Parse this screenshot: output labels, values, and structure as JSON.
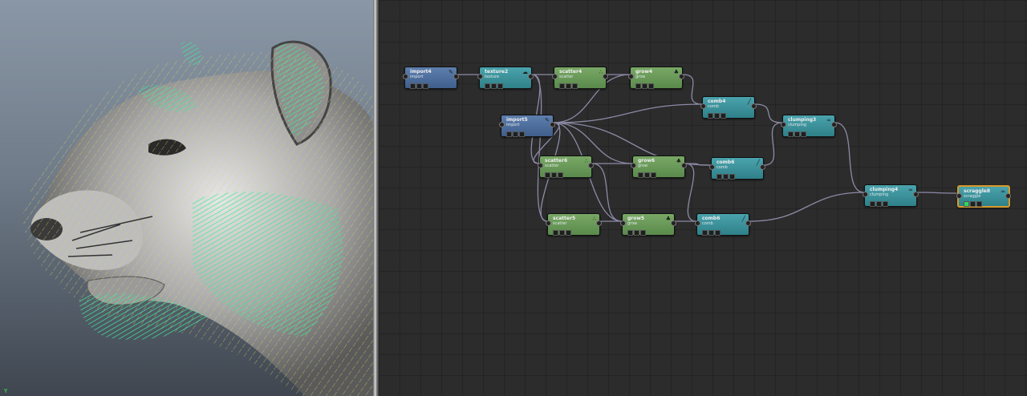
{
  "viewport": {
    "axis_indicator": "Y"
  },
  "graph": {
    "nodes": [
      {
        "id": "import4",
        "title": "import4",
        "type": "import",
        "color": "blue",
        "icon": "brush-icon",
        "selected": false
      },
      {
        "id": "texture2",
        "title": "texture2",
        "type": "texture",
        "color": "teal",
        "icon": "cloud-icon",
        "selected": false
      },
      {
        "id": "scatter4",
        "title": "scatter4",
        "type": "scatter",
        "color": "green",
        "icon": "scatter-dots-icon",
        "selected": false
      },
      {
        "id": "grow4",
        "title": "grow4",
        "type": "grow",
        "color": "green",
        "icon": "sprout-icon",
        "selected": false
      },
      {
        "id": "comb4",
        "title": "comb4",
        "type": "comb",
        "color": "teal",
        "icon": "comb-icon",
        "selected": false
      },
      {
        "id": "clumping3",
        "title": "clumping3",
        "type": "clumping",
        "color": "teal",
        "icon": "clump-icon",
        "selected": false
      },
      {
        "id": "import5",
        "title": "import5",
        "type": "import",
        "color": "blue",
        "icon": "brush-icon",
        "selected": false
      },
      {
        "id": "scatter6",
        "title": "scatter6",
        "type": "scatter",
        "color": "green",
        "icon": "scatter-dots-icon",
        "selected": false
      },
      {
        "id": "grow6",
        "title": "grow6",
        "type": "grow",
        "color": "green",
        "icon": "sprout-icon",
        "selected": false
      },
      {
        "id": "comb6a",
        "title": "comb6",
        "type": "comb",
        "color": "teal",
        "icon": "comb-icon",
        "selected": false
      },
      {
        "id": "clumping4",
        "title": "clumping4",
        "type": "clumping",
        "color": "teal",
        "icon": "clump-icon",
        "selected": false
      },
      {
        "id": "scraggle8",
        "title": "scraggle8",
        "type": "scraggle",
        "color": "teal",
        "icon": "scraggle-icon",
        "selected": true
      },
      {
        "id": "scatter5",
        "title": "scatter5",
        "type": "scatter",
        "color": "green",
        "icon": "scatter-dots-icon",
        "selected": false
      },
      {
        "id": "grow5",
        "title": "grow5",
        "type": "grow",
        "color": "green",
        "icon": "sprout-icon",
        "selected": false
      },
      {
        "id": "comb6b",
        "title": "comb6",
        "type": "comb",
        "color": "teal",
        "icon": "comb-icon",
        "selected": false
      }
    ],
    "connections": [
      [
        "import4",
        "texture2"
      ],
      [
        "texture2",
        "scatter4"
      ],
      [
        "scatter4",
        "grow4"
      ],
      [
        "grow4",
        "comb4"
      ],
      [
        "comb4",
        "clumping3"
      ],
      [
        "import5",
        "comb4"
      ],
      [
        "import5",
        "scatter6"
      ],
      [
        "import5",
        "grow6"
      ],
      [
        "import5",
        "comb6a"
      ],
      [
        "import5",
        "scatter5"
      ],
      [
        "import5",
        "grow5"
      ],
      [
        "import5",
        "grow4"
      ],
      [
        "texture2",
        "scatter6"
      ],
      [
        "texture2",
        "scatter5"
      ],
      [
        "scatter6",
        "grow6"
      ],
      [
        "grow6",
        "comb6a"
      ],
      [
        "comb6a",
        "clumping3"
      ],
      [
        "clumping3",
        "clumping4"
      ],
      [
        "clumping4",
        "scraggle8"
      ],
      [
        "scatter5",
        "grow5"
      ],
      [
        "grow5",
        "comb6b"
      ],
      [
        "comb6b",
        "clumping4"
      ],
      [
        "scatter6",
        "grow5"
      ],
      [
        "grow6",
        "comb6b"
      ]
    ]
  }
}
